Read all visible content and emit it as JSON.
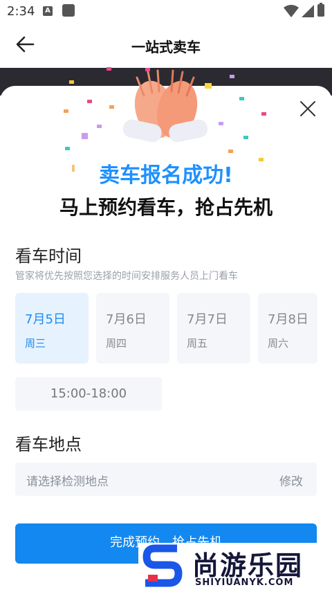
{
  "status_bar": {
    "time": "2:34",
    "notification_icon": "A"
  },
  "header": {
    "title": "一站式卖车",
    "back_icon": "arrow-left-icon"
  },
  "dialog": {
    "close_icon": "close-icon",
    "illustration": "high-five-hands-icon",
    "success_title": "卖车报名成功!",
    "success_subtitle": "马上预约看车，抢占先机"
  },
  "viewing_time": {
    "title": "看车时间",
    "hint": "管家将优先按照您选择的时间安排服务人员上门看车",
    "dates": [
      {
        "date": "7月5日",
        "weekday": "周三",
        "selected": true
      },
      {
        "date": "7月6日",
        "weekday": "周四",
        "selected": false
      },
      {
        "date": "7月7日",
        "weekday": "周五",
        "selected": false
      },
      {
        "date": "7月8日",
        "weekday": "周六",
        "selected": false
      }
    ],
    "time_slot": "15:00-18:00"
  },
  "viewing_location": {
    "title": "看车地点",
    "placeholder": "请选择检测地点",
    "edit_label": "修改"
  },
  "submit_label": "完成预约，抢占先机",
  "watermark": {
    "brand": "尚游乐园",
    "url": "SHIYIUANYK.COM"
  },
  "colors": {
    "accent": "#1288f0",
    "title_blue": "#1e90ff",
    "selected_bg": "#e6f2fd",
    "card_bg": "#f4f6fa"
  }
}
